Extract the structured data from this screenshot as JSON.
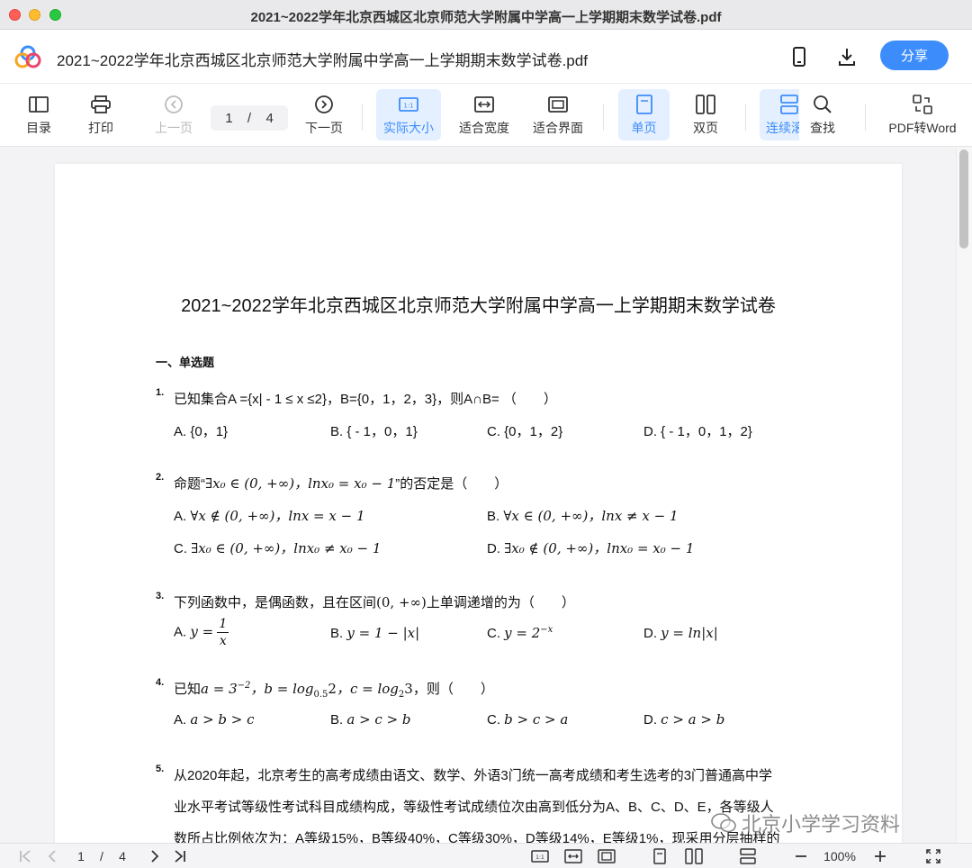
{
  "window": {
    "title": "2021~2022学年北京西城区北京师范大学附属中学高一上学期期末数学试卷.pdf"
  },
  "header": {
    "doc_title": "2021~2022学年北京西城区北京师范大学附属中学高一上学期期末数学试卷.pdf",
    "share_label": "分享",
    "icons": [
      "phone-icon",
      "download-icon"
    ]
  },
  "toolbar": {
    "toc": "目录",
    "print": "打印",
    "prev": "上一页",
    "page_current": "1",
    "page_sep": "/",
    "page_total": "4",
    "next": "下一页",
    "actual_size": "实际大小",
    "fit_width": "适合宽度",
    "fit_page": "适合界面",
    "single": "单页",
    "double": "双页",
    "continuous": "连续滚",
    "search": "查找",
    "pdf_to_word": "PDF转Word"
  },
  "accent_color": "#3c8dfb",
  "document": {
    "title": "2021~2022学年北京西城区北京师范大学附属中学高一上学期期末数学试卷",
    "section": "一、单选题",
    "q1": {
      "num": "1.",
      "text": "已知集合A ={x| - 1 ≤ x ≤2}，B={0，1，2，3}，则A∩B= （　　）",
      "a": "A. {0，1}",
      "b": "B. { - 1，0，1}",
      "c": "C. {0，1，2}",
      "d": "D. { - 1，0，1，2}"
    },
    "q2": {
      "num": "2.",
      "pre": "命题“",
      "math": "∃x₀ ∈ (0, +∞)，lnx₀ = x₀ − 1",
      "post": "”的否定是（　　）",
      "a_label": "A.",
      "a": "∀x ∉ (0, +∞)，lnx = x − 1",
      "b_label": "B.",
      "b": "∀x ∈ (0, +∞)，lnx ≠ x − 1",
      "c_label": "C.",
      "c": "∃x₀ ∈ (0, +∞)，lnx₀ ≠ x₀ − 1",
      "d_label": "D.",
      "d": "∃x₀ ∉ (0, +∞)，lnx₀ = x₀ − 1"
    },
    "q3": {
      "num": "3.",
      "pre": "下列函数中，是偶函数，且在区间",
      "math": "(0, +∞)",
      "post": "上单调递增的为（　　）",
      "a_label": "A.",
      "a_lhs": "y =",
      "a_num": "1",
      "a_den": "x",
      "b_label": "B.",
      "b": "y = 1 − |x|",
      "c_label": "C.",
      "c_base": "y = 2",
      "c_exp": "−x",
      "d_label": "D.",
      "d": "y = ln|x|"
    },
    "q4": {
      "num": "4.",
      "pre": "已知",
      "a_part": "a = 3",
      "a_exp": "−2",
      "b_part": "，b = log",
      "b_sub": "0.5",
      "b_tail": "2",
      "c_part": "，c = log",
      "c_sub": "2",
      "c_tail": "3",
      "post": "，则（　　）",
      "opt_a_label": "A.",
      "opt_a": "a > b > c",
      "opt_b_label": "B.",
      "opt_b": "a > c > b",
      "opt_c_label": "C.",
      "opt_c": "b > c > a",
      "opt_d_label": "D.",
      "opt_d": "c > a > b"
    },
    "q5": {
      "num": "5.",
      "line1": "从2020年起，北京考生的高考成绩由语文、数学、外语3门统一高考成绩和考生选考的3门普通高中学",
      "line2": "业水平考试等级性考试科目成绩构成，等级性考试成绩位次由高到低分为A、B、C、D、E，各等级人",
      "line3": "数所占比例依次为：A等级15%，B等级40%，C等级30%，D等级14%，E等级1%，现采用分层抽样的"
    },
    "watermark": "北京小学学习资料"
  },
  "bottombar": {
    "page_current": "1",
    "page_sep": "/",
    "page_total": "4",
    "zoom": "100%"
  }
}
